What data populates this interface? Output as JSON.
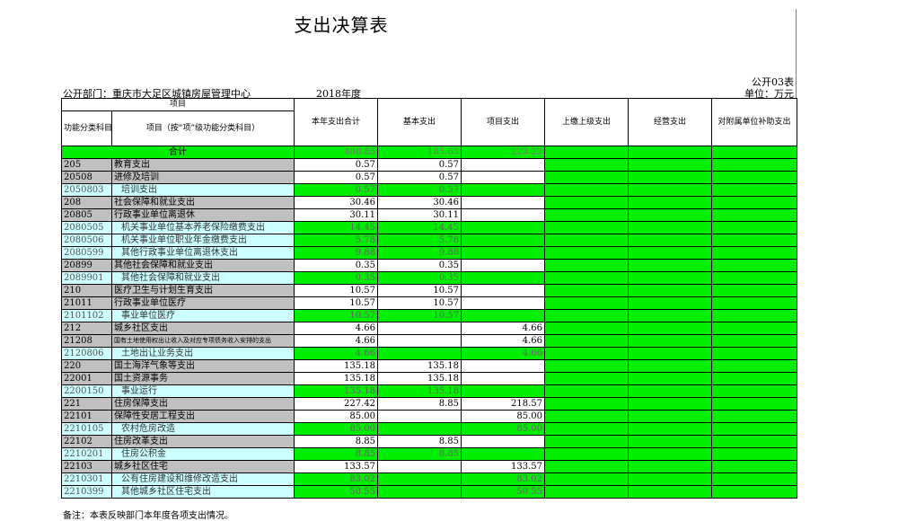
{
  "page": {
    "title": "支出决算表",
    "form_code": "公开03表",
    "unit": "单位：万元",
    "dept": "公开部门：重庆市大足区城镇房屋管理中心",
    "year": "2018年度",
    "note": "备注：本表反映部门本年度各项支出情况。"
  },
  "headers": {
    "item": "项目",
    "code": "功能分类科目编码",
    "name": "项目（按“项”级功能分类科目）",
    "total": "本年支出合计",
    "basic": "基本支出",
    "project": "项目支出",
    "upper": "上缴上级支出",
    "business": "经营支出",
    "subsidy": "对附属单位补助支出"
  },
  "total_row": {
    "label": "合计",
    "total": "408.85",
    "basic": "185.63",
    "project": "223.22"
  },
  "rows": [
    {
      "code": "205",
      "name": "教育支出",
      "total": "0.57",
      "basic": "0.57",
      "project": "",
      "level": "group"
    },
    {
      "code": "20508",
      "name": "进修及培训",
      "total": "0.57",
      "basic": "0.57",
      "project": "",
      "level": "group"
    },
    {
      "code": "2050803",
      "name": "培训支出",
      "total": "0.57",
      "basic": "0.57",
      "project": "",
      "level": "leaf"
    },
    {
      "code": "208",
      "name": "社会保障和就业支出",
      "total": "30.46",
      "basic": "30.46",
      "project": "",
      "level": "group"
    },
    {
      "code": "20805",
      "name": "行政事业单位离退休",
      "total": "30.11",
      "basic": "30.11",
      "project": "",
      "level": "group"
    },
    {
      "code": "2080505",
      "name": "机关事业单位基本养老保险缴费支出",
      "total": "14.45",
      "basic": "14.45",
      "project": "",
      "level": "leaf"
    },
    {
      "code": "2080506",
      "name": "机关事业单位职业年金缴费支出",
      "total": "5.78",
      "basic": "5.78",
      "project": "",
      "level": "leaf"
    },
    {
      "code": "2080599",
      "name": "其他行政事业单位离退休支出",
      "total": "9.88",
      "basic": "9.88",
      "project": "",
      "level": "leaf"
    },
    {
      "code": "20899",
      "name": "其他社会保障和就业支出",
      "total": "0.35",
      "basic": "0.35",
      "project": "",
      "level": "group"
    },
    {
      "code": "2089901",
      "name": "其他社会保障和就业支出",
      "total": "0.35",
      "basic": "0.35",
      "project": "",
      "level": "leaf"
    },
    {
      "code": "210",
      "name": "医疗卫生与计划生育支出",
      "total": "10.57",
      "basic": "10.57",
      "project": "",
      "level": "group"
    },
    {
      "code": "21011",
      "name": "行政事业单位医疗",
      "total": "10.57",
      "basic": "10.57",
      "project": "",
      "level": "group"
    },
    {
      "code": "2101102",
      "name": "事业单位医疗",
      "total": "10.57",
      "basic": "10.57",
      "project": "",
      "level": "leaf"
    },
    {
      "code": "212",
      "name": "城乡社区支出",
      "total": "4.66",
      "basic": "",
      "project": "4.66",
      "level": "group"
    },
    {
      "code": "21208",
      "name": "国有土地使用权出让收入及对应专项债务收入安排的支出",
      "total": "4.66",
      "basic": "",
      "project": "4.66",
      "level": "group",
      "tiny": true
    },
    {
      "code": "2120806",
      "name": "土地出让业务支出",
      "total": "4.66",
      "basic": "",
      "project": "4.66",
      "level": "leaf"
    },
    {
      "code": "220",
      "name": "国土海洋气象等支出",
      "total": "135.18",
      "basic": "135.18",
      "project": "",
      "level": "group"
    },
    {
      "code": "22001",
      "name": "国土资源事务",
      "total": "135.18",
      "basic": "135.18",
      "project": "",
      "level": "group"
    },
    {
      "code": "2200150",
      "name": "事业运行",
      "total": "135.18",
      "basic": "135.18",
      "project": "",
      "level": "leaf"
    },
    {
      "code": "221",
      "name": "住房保障支出",
      "total": "227.42",
      "basic": "8.85",
      "project": "218.57",
      "level": "group"
    },
    {
      "code": "22101",
      "name": "保障性安居工程支出",
      "total": "85.00",
      "basic": "",
      "project": "85.00",
      "level": "group"
    },
    {
      "code": "2210105",
      "name": "农村危房改造",
      "total": "85.00",
      "basic": "",
      "project": "85.00",
      "level": "leaf"
    },
    {
      "code": "22102",
      "name": "住房改革支出",
      "total": "8.85",
      "basic": "8.85",
      "project": "",
      "level": "group"
    },
    {
      "code": "2210201",
      "name": "住房公积金",
      "total": "8.85",
      "basic": "8.85",
      "project": "",
      "level": "leaf"
    },
    {
      "code": "22103",
      "name": "城乡社区住宅",
      "total": "133.57",
      "basic": "",
      "project": "133.57",
      "level": "group"
    },
    {
      "code": "2210301",
      "name": "公有住房建设和维修改造支出",
      "total": "83.02",
      "basic": "",
      "project": "83.02",
      "level": "leaf"
    },
    {
      "code": "2210399",
      "name": "其他城乡社区住宅支出",
      "total": "50.55",
      "basic": "",
      "project": "50.55",
      "level": "leaf"
    }
  ],
  "colors": {
    "amount_cell": "#00ee00",
    "group_row": "#c0c0c0",
    "leaf_row": "#ccffff"
  }
}
